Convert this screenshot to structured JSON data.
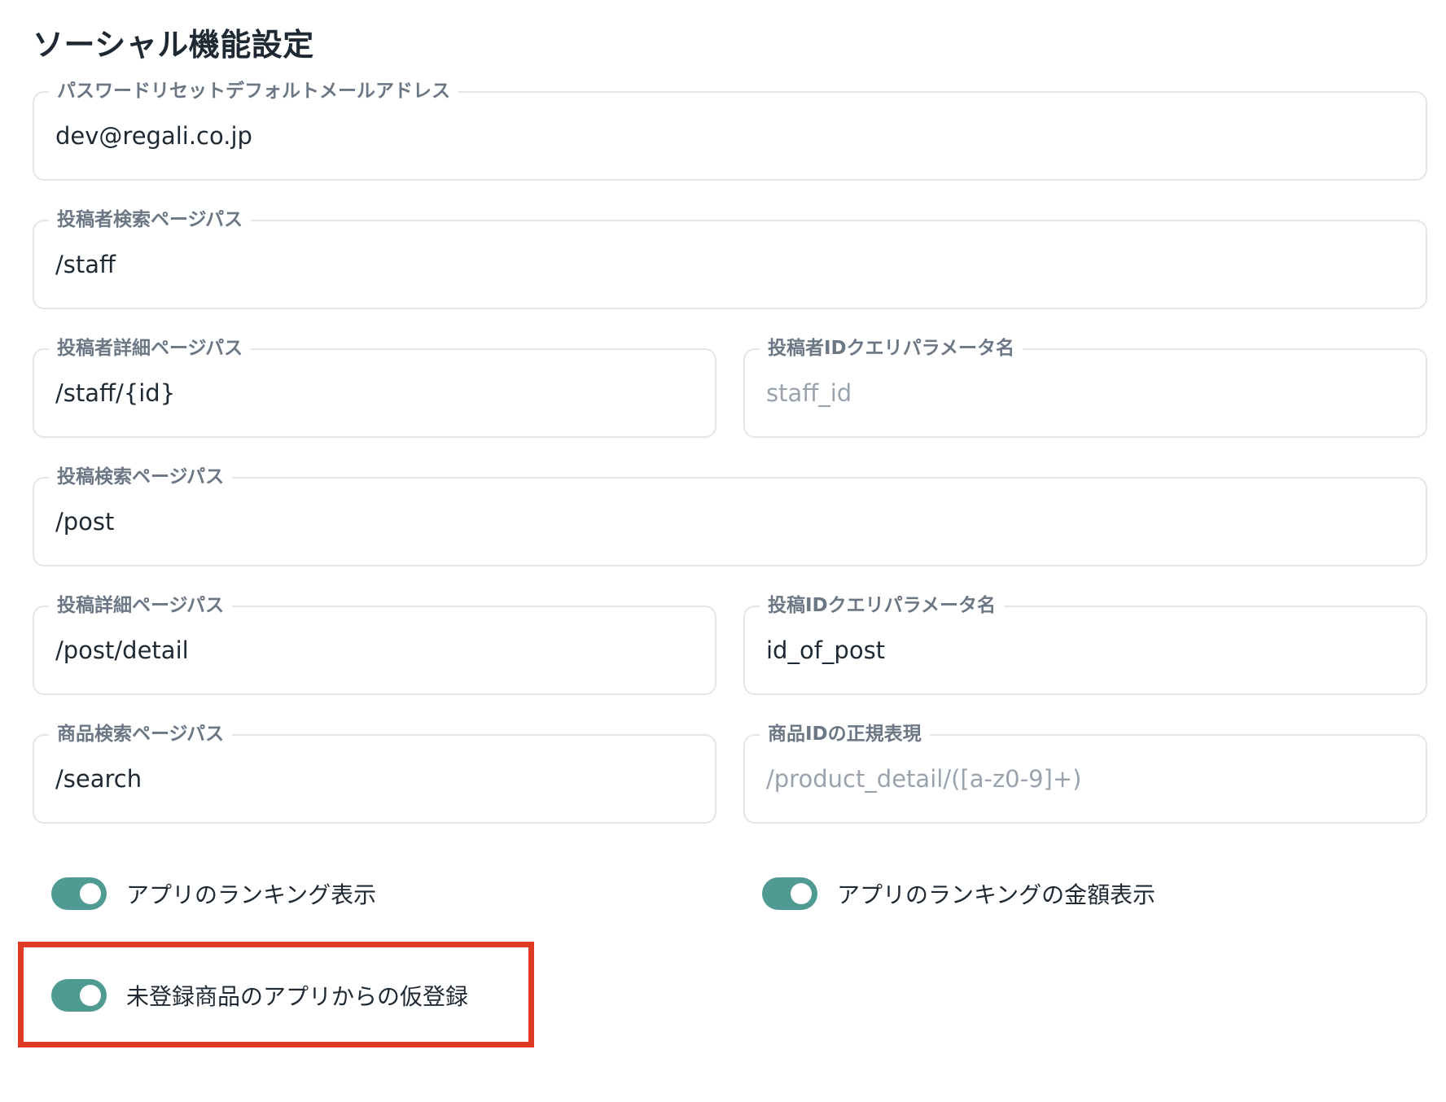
{
  "page_title": "ソーシャル機能設定",
  "fields": {
    "password_reset_email": {
      "label": "パスワードリセットデフォルトメールアドレス",
      "value": "dev@regali.co.jp"
    },
    "poster_search_path": {
      "label": "投稿者検索ページパス",
      "value": "/staff"
    },
    "poster_detail_path": {
      "label": "投稿者詳細ページパス",
      "value": "/staff/{id}"
    },
    "poster_id_query_param": {
      "label": "投稿者IDクエリパラメータ名",
      "placeholder": "staff_id"
    },
    "post_search_path": {
      "label": "投稿検索ページパス",
      "value": "/post"
    },
    "post_detail_path": {
      "label": "投稿詳細ページパス",
      "value": "/post/detail"
    },
    "post_id_query_param": {
      "label": "投稿IDクエリパラメータ名",
      "value": "id_of_post"
    },
    "product_search_path": {
      "label": "商品検索ページパス",
      "value": "/search"
    },
    "product_id_regex": {
      "label": "商品IDの正規表現",
      "placeholder": "/product_detail/([a-z0-9]+)"
    }
  },
  "toggles": {
    "app_ranking_display": {
      "label": "アプリのランキング表示",
      "checked": true
    },
    "app_ranking_amount_display": {
      "label": "アプリのランキングの金額表示",
      "checked": true
    },
    "unregistered_product_temp_registration": {
      "label": "未登録商品のアプリからの仮登録",
      "checked": true
    }
  },
  "colors": {
    "toggle_on": "#4f9b94",
    "highlight": "#e03a25",
    "border": "#e3e6ea",
    "label": "#6b7785",
    "placeholder": "#9aa3ad"
  }
}
